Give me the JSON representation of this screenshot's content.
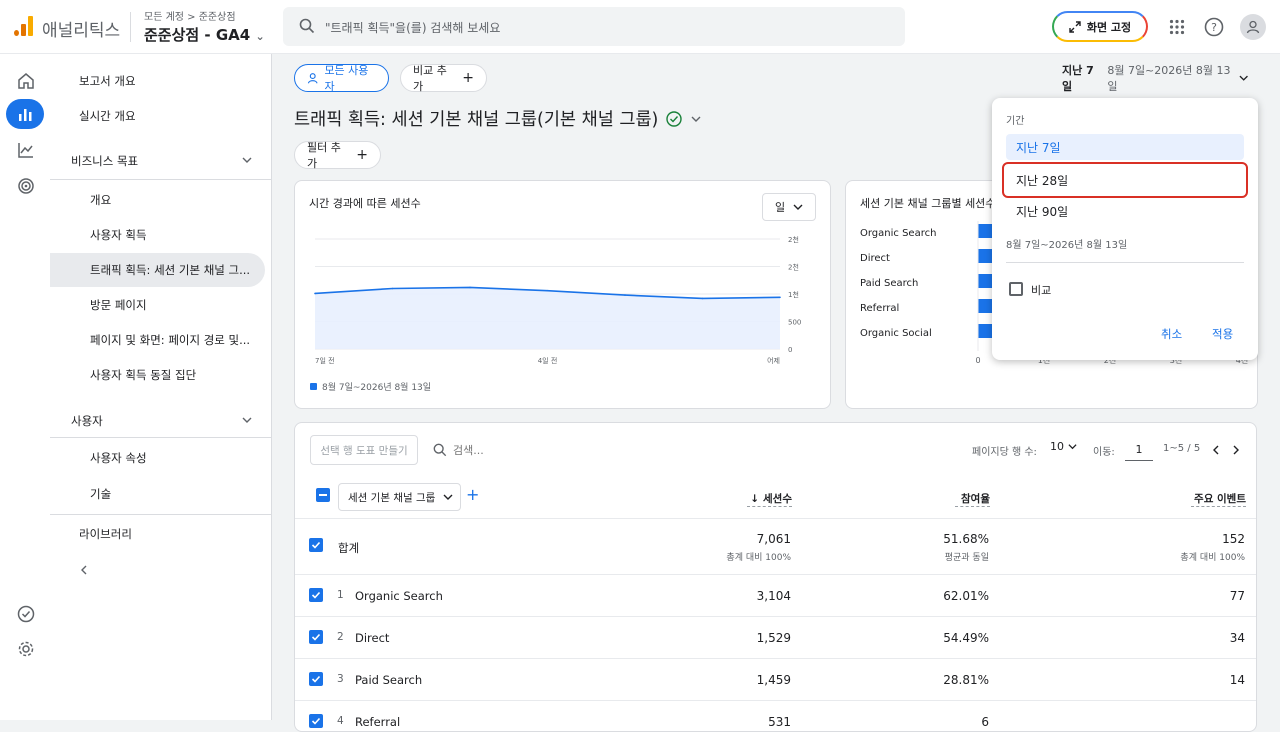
{
  "header": {
    "brand": "애널리틱스",
    "breadcrumb": "모든 계정 > 준준상점",
    "property": "준준상점 - GA4",
    "search_placeholder": "\"트래픽 획득\"을(를) 검색해 보세요",
    "pin_label": "화면 고정"
  },
  "nav": {
    "report_overview": "보고서 개요",
    "realtime": "실시간 개요",
    "business_goals": "비즈니스 목표",
    "overview": "개요",
    "user_acquisition": "사용자 획득",
    "traffic_acquisition": "트래픽 획득: 세션 기본 채널 그...",
    "landing_page": "방문 페이지",
    "pages_screens": "페이지 및 화면: 페이지 경로 및...",
    "cohort": "사용자 획득 동질 집단",
    "users": "사용자",
    "user_attributes": "사용자 속성",
    "tech": "기술",
    "library": "라이브러리"
  },
  "toolbar": {
    "all_users": "모든 사용자",
    "add_comparison": "비교 추가",
    "date_label": "지난 7일",
    "date_range": "8월 7일~2026년 8월 13일",
    "add_filter": "필터 추가"
  },
  "page_title": "트래픽 획득: 세션 기본 채널 그룹(기본 채널 그룹)",
  "line_card": {
    "title": "시간 경과에 따른 세션수",
    "granularity": "일",
    "y_ticks": [
      "2천",
      "2천",
      "1천",
      "500",
      "0"
    ],
    "x_ticks": [
      "7일 전",
      "4일 전",
      "어제"
    ],
    "legend": "8월 7일~2026년 8월 13일"
  },
  "bar_card": {
    "title": "세션 기본 채널 그룹별 세션수",
    "x_ticks": [
      "0",
      "1천",
      "2천",
      "3천",
      "4천"
    ]
  },
  "chart_data": [
    {
      "type": "area",
      "title": "시간 경과에 따른 세션수",
      "x": [
        "7일 전",
        "",
        "",
        "4일 전",
        "",
        "",
        "어제"
      ],
      "values": [
        1010,
        1100,
        1120,
        1060,
        980,
        920,
        940
      ],
      "ylim": [
        0,
        2000
      ],
      "series": [
        {
          "name": "8월 7일~2026년 8월 13일",
          "values": [
            1010,
            1100,
            1120,
            1060,
            980,
            920,
            940
          ]
        }
      ]
    },
    {
      "type": "bar",
      "title": "세션 기본 채널 그룹별 세션수",
      "categories": [
        "Organic Search",
        "Direct",
        "Paid Search",
        "Referral",
        "Organic Social"
      ],
      "values": [
        3104,
        1529,
        1459,
        531,
        400
      ]
    }
  ],
  "table": {
    "make_chart": "선택 행 도표 만들기",
    "search_placeholder": "검색...",
    "rows_per_page_label": "페이지당 행 수:",
    "rows_per_page": "10",
    "goto_label": "이동:",
    "goto_value": "1",
    "page_info": "1~5 / 5",
    "dimension": "세션 기본 채널 그룹",
    "col_sessions": "세션수",
    "col_engagement": "참여율",
    "col_key_events": "주요 이벤트",
    "total_label": "합계",
    "total": {
      "sessions": "7,061",
      "sessions_sub": "총계 대비 100%",
      "engagement": "51.68%",
      "engagement_sub": "평균과 동일",
      "key_events": "152",
      "key_events_sub": "총계 대비 100%"
    },
    "rows": [
      {
        "idx": "1",
        "name": "Organic Search",
        "sessions": "3,104",
        "engagement": "62.01%",
        "key_events": "77"
      },
      {
        "idx": "2",
        "name": "Direct",
        "sessions": "1,529",
        "engagement": "54.49%",
        "key_events": "34"
      },
      {
        "idx": "3",
        "name": "Paid Search",
        "sessions": "1,459",
        "engagement": "28.81%",
        "key_events": "14"
      },
      {
        "idx": "4",
        "name": "Referral",
        "sessions": "531",
        "engagement": "6",
        "key_events": ""
      }
    ]
  },
  "date_dropdown": {
    "label": "기간",
    "option_7": "지난 7일",
    "option_28": "지난 28일",
    "option_90": "지난 90일",
    "range": "8월 7일~2026년 8월 13일",
    "compare": "비교",
    "cancel": "취소",
    "apply": "적용"
  },
  "colors": {
    "accent": "#1a73e8",
    "highlight": "#d93025",
    "bar": "#1a73e8"
  }
}
